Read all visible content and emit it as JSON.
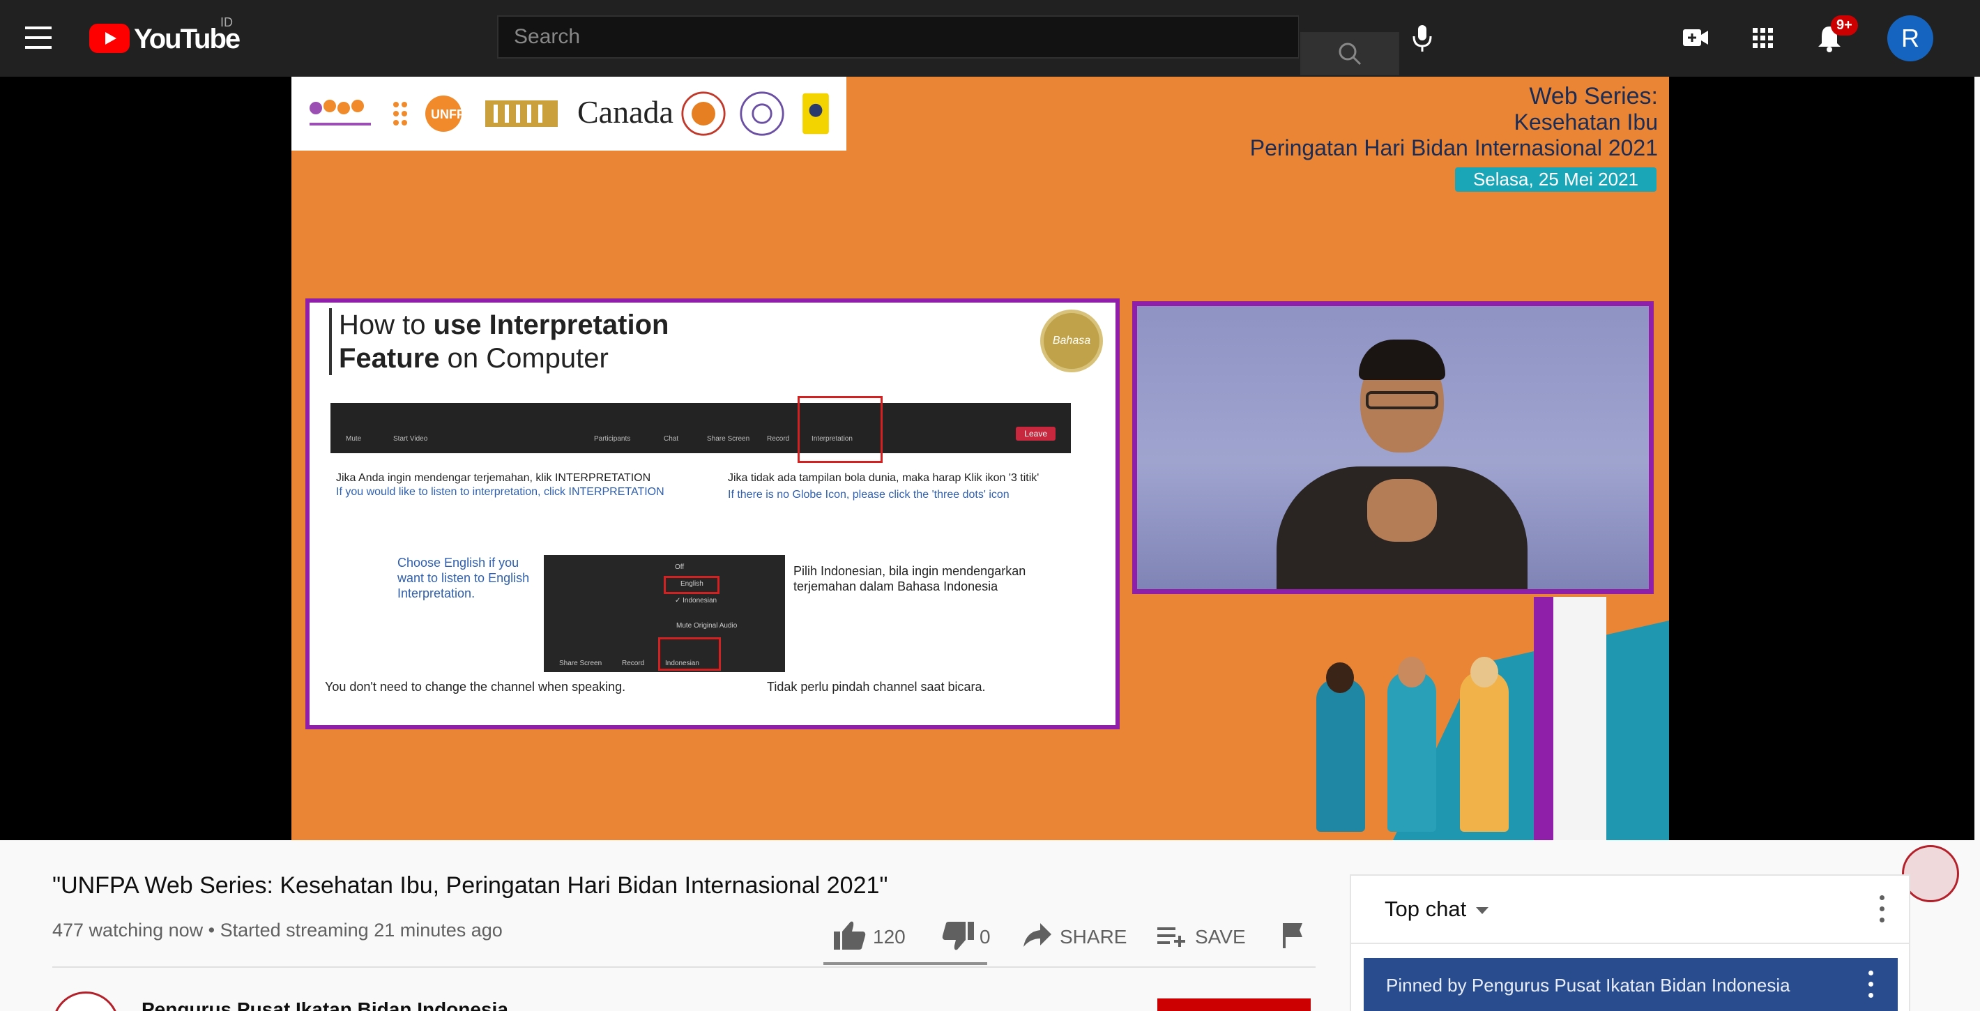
{
  "header": {
    "logo_text": "YouTube",
    "country_code": "ID",
    "search_placeholder": "Search",
    "notifications_badge": "9+",
    "avatar_letter": "R"
  },
  "video": {
    "logos": [
      "Knowledge Hub",
      "UNFPA",
      "Kantor Staf Presiden",
      "Canada"
    ],
    "canada_text": "Canada",
    "series_title": "Web Series:",
    "series_subtitle": "Kesehatan Ibu",
    "series_event": "Peringatan Hari Bidan Internasional 2021",
    "series_date": "Selasa, 25 Mei 2021",
    "slide": {
      "title_a": "How to ",
      "title_b": "use Interpretation",
      "title_c": "Feature",
      "title_d": " on Computer",
      "seal": "Bahasa",
      "toolbar": [
        "Mute",
        "Start Video",
        "Participants",
        "Chat",
        "Share Screen",
        "Record",
        "Interpretation"
      ],
      "leave": "Leave",
      "left_id": "Jika Anda ingin mendengar terjemahan, klik INTERPRETATION",
      "left_en": "If you would like to listen to interpretation, click INTERPRETATION",
      "right_id": "Jika tidak ada tampilan bola dunia, maka harap Klik ikon '3 titik'",
      "right_en": "If there is no Globe Icon, please click the 'three dots' icon",
      "choose_en": "Choose English if you want to listen to English Interpretation.",
      "choose_id": "Pilih Indonesian, bila ingin mendengarkan terjemahan dalam Bahasa Indonesia",
      "menu_off": "Off",
      "menu_english": "English",
      "menu_indonesian": "✓ Indonesian",
      "menu_mute": "Mute Original Audio",
      "mini_share": "Share Screen",
      "mini_record": "Record",
      "mini_indo": "Indonesian",
      "foot_en": "You don't need to change the channel when speaking.",
      "foot_id": "Tidak perlu pindah channel saat bicara."
    }
  },
  "info": {
    "title": "\"UNFPA Web Series: Kesehatan Ibu, Peringatan Hari Bidan Internasional 2021\"",
    "meta": "477 watching now • Started streaming 21 minutes ago",
    "likes": "120",
    "dislikes": "0",
    "share": "SHARE",
    "save": "SAVE",
    "channel_name": "Pengurus Pusat Ikatan Bidan Indonesia"
  },
  "chat": {
    "mode": "Top chat",
    "pinned": "Pinned by Pengurus Pusat Ikatan Bidan Indonesia"
  },
  "colors": {
    "brand_red": "#ff0000",
    "video_orange": "#ea8535",
    "slide_purple": "#8f1ea8",
    "pinned_blue": "#284c8e"
  }
}
